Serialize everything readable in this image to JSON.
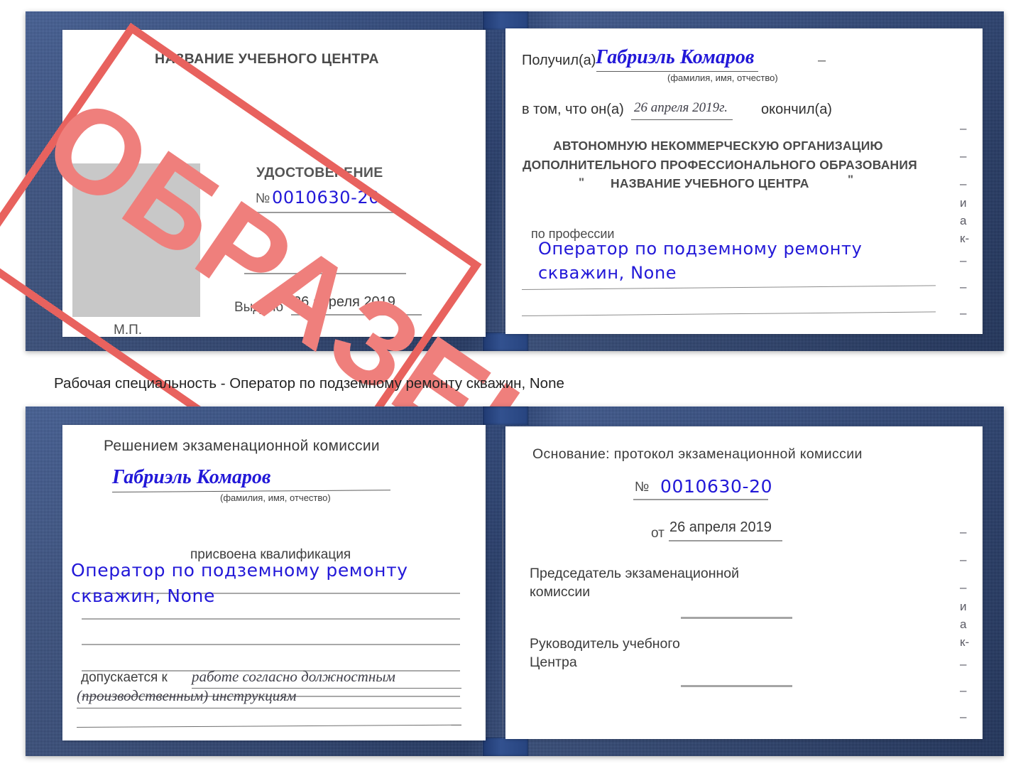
{
  "caption": "Рабочая специальность - Оператор по подземному ремонту скважин, None",
  "colors": {
    "cover_blue": "#26417c",
    "stamp_red": "#e8625e",
    "ink_blue": "#2218d8",
    "photo_gray": "#c8c8c8"
  },
  "stamp": {
    "text": "ОБРАЗЕЦ"
  },
  "certificate_top": {
    "left_page": {
      "header": "НАЗВАНИЕ УЧЕБНОГО ЦЕНТРА",
      "doc_type": "УДОСТОВЕРЕНИЕ",
      "number_label": "№",
      "number_value": "0010630-20",
      "issued_label": "Выдано",
      "issued_value": "26 апреля 2019",
      "seal_label": "М.П.",
      "photo_placeholder": "photo-placeholder"
    },
    "right_page": {
      "received_label": "Получил(а)",
      "received_value": "Габриэль Комаров",
      "name_hint": "(фамилия, имя, отчество)",
      "that_he_label": "в том, что он(а)",
      "completion_date": "26 апреля 2019г.",
      "graduated_label": "окончил(а)",
      "org_line1": "АВТОНОМНУЮ НЕКОММЕРЧЕСКУЮ ОРГАНИЗАЦИЮ",
      "org_line2": "ДОПОЛНИТЕЛЬНОГО ПРОФЕССИОНАЛЬНОГО ОБРАЗОВАНИЯ",
      "org_quote_open": "\"",
      "org_name": "НАЗВАНИЕ УЧЕБНОГО ЦЕНТРА",
      "org_quote_close": "\"",
      "profession_label": "по профессии",
      "profession_value_line1": "Оператор по подземному ремонту",
      "profession_value_line2": "скважин, None",
      "margin_chars": [
        "–",
        "–",
        "–",
        "и",
        "а",
        "к-",
        "–",
        "–",
        "–"
      ]
    }
  },
  "certificate_bottom": {
    "left_page": {
      "header": "Решением экзаменационной комиссии",
      "name_value": "Габриэль Комаров",
      "name_hint": "(фамилия, имя, отчество)",
      "qualification_label": "присвоена квалификация",
      "qualification_line1": "Оператор по подземному ремонту",
      "qualification_line2": "скважин, None",
      "admitted_label": "допускается к",
      "admitted_value_line1": "работе согласно должностным",
      "admitted_value_line2": "(производственным) инструкциям"
    },
    "right_page": {
      "basis_label": "Основание: протокол экзаменационной комиссии",
      "number_label": "№",
      "number_value": "0010630-20",
      "from_label": "от",
      "from_value": "26 апреля 2019",
      "chairman_line1": "Председатель экзаменационной",
      "chairman_line2": "комиссии",
      "director_line1": "Руководитель учебного",
      "director_line2": "Центра",
      "margin_chars": [
        "–",
        "–",
        "–",
        "и",
        "а",
        "к-",
        "–",
        "–",
        "–",
        "–"
      ]
    }
  }
}
